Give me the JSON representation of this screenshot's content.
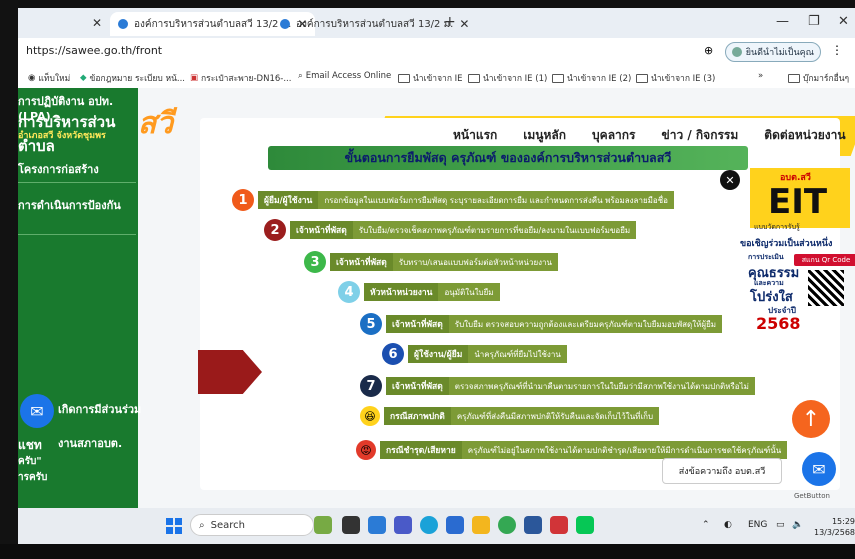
{
  "browser": {
    "tabs": [
      {
        "label": "องค์การบริหารส่วนตำบลสวี 13/2 ม."
      },
      {
        "label": "องค์การบริหารส่วนตำบลสวี 13/2 ม."
      }
    ],
    "new_tab": "+",
    "url": "https://sawee.go.th/front",
    "profile_label": "ยินดีนำไม่เป็นคุณ",
    "bookmarks": [
      "แท็บใหม่",
      "ข้อกฎหมาย ระเบียบ หน้...",
      "กระเป๋าสะพาย-DN16-...",
      "Email Access Online",
      "นำเข้าจาก IE",
      "นำเข้าจาก IE (1)",
      "นำเข้าจาก IE (2)",
      "นำเข้าจาก IE (3)",
      "»",
      "บุ๊กมาร์กอื่นๆ"
    ]
  },
  "sidebar": {
    "org_top": "การปฏิบัติงาน อปท. (LPA)",
    "org_name": "การบริหารส่วนตำบล",
    "org_sub": "อำเภอสวี จังหวัดชุมพร",
    "logo_text": "สวี",
    "items": [
      {
        "label": "โครงการก่อสร้าง"
      },
      {
        "label": "การดำเนินการป้องกัน"
      }
    ],
    "bottom_items": [
      "เกิดการมีส่วนร่วม",
      "งานสภาอบต."
    ],
    "chat_partial_1": "แชท",
    "chat_partial_2": "ครับ\"",
    "chat_partial_3": "ารครับ"
  },
  "topmenu": {
    "items": [
      "หน้าแรก",
      "เมนูหลัก",
      "บุคลากร",
      "ข่าว / กิจกรรม",
      "ติดต่อหน่วยงาน"
    ]
  },
  "content": {
    "heading": "ขั้นตอนการยืมพัสดุ ครุภัณฑ์ ขององค์การบริหารส่วนตำบลสวี",
    "steps": [
      {
        "num": "1",
        "role": "ผู้ยืม/ผู้ใช้งาน",
        "desc": "กรอกข้อมูลในแบบฟอร์มการยืมพัสดุ ระบุรายละเอียดการยืม และกำหนดการส่งคืน พร้อมลงลายมือชื่อ",
        "color": "#f05a1a"
      },
      {
        "num": "2",
        "role": "เจ้าหน้าที่พัสดุ",
        "desc": "รับใบยืม/ตรวจเช็คสภาพครุภัณฑ์ตามรายการที่ขอยืม/ลงนามในแบบฟอร์มขอยืม",
        "color": "#9b1e1e"
      },
      {
        "num": "3",
        "role": "เจ้าหน้าที่พัสดุ",
        "desc": "รับทราบ/เสนอแบบฟอร์มต่อหัวหน้าหน่วยงาน",
        "color": "#3db84a"
      },
      {
        "num": "4",
        "role": "หัวหน้าหน่วยงาน",
        "desc": "อนุมัติในใบยืม",
        "color": "#7fd0e8"
      },
      {
        "num": "5",
        "role": "เจ้าหน้าที่พัสดุ",
        "desc": "รับใบยืม ตรวจสอบความถูกต้องและเตรียมครุภัณฑ์ตามใบยืมมอบพัสดุให้ผู้ยืม",
        "color": "#1b6fc4"
      },
      {
        "num": "6",
        "role": "ผู้ใช้งาน/ผู้ยืม",
        "desc": "นำครุภัณฑ์ที่ยืมไปใช้งาน",
        "color": "#1b4fb0"
      },
      {
        "num": "7",
        "role": "เจ้าหน้าที่พัสดุ",
        "desc": "ตรวจสภาพครุภัณฑ์ที่นำมาคืนตามรายการในใบยืมว่ามีสภาพใช้งานได้ตามปกติหรือไม่",
        "color": "#1a2b4a"
      }
    ],
    "outcomes": [
      {
        "role": "กรณีสภาพปกติ",
        "desc": "ครุภัณฑ์ที่ส่งคืนมีสภาพปกติให้รับคืนและจัดเก็บไว้ในที่เก็บ",
        "emoji": "😆",
        "color": "#ffd21c"
      },
      {
        "role": "กรณีชำรุด/เสียหาย",
        "desc": "ครุภัณฑ์ไม่อยู่ในสภาพใช้งานได้ตามปกติชำรุด/เสียหายให้มีการดำเนินการชดใช้ครุภัณฑ์นั้น",
        "emoji": "😡",
        "color": "#e23a2a"
      }
    ]
  },
  "eit": {
    "top": "อบต.สวี",
    "big": "EIT",
    "sub": "แบบวัดการรับรู้",
    "invite": "ขอเชิญร่วมเป็นส่วนหนึ่ง",
    "line1": "การประเมิน",
    "line2": "คุณธรรม",
    "line3": "และความ",
    "line4": "โปร่งใส",
    "fiscal": "ประจำปี",
    "year": "2568",
    "scan": "สแกน Qr Code",
    "close": "✕"
  },
  "widgets": {
    "tooltip": "ส่งข้อความถึง อบต.สวี",
    "getbutton": "GetButton",
    "scroll_up": "↑"
  },
  "taskbar": {
    "search": "Search",
    "lang": "ENG",
    "time": "15:29",
    "date": "13/3/2568"
  }
}
